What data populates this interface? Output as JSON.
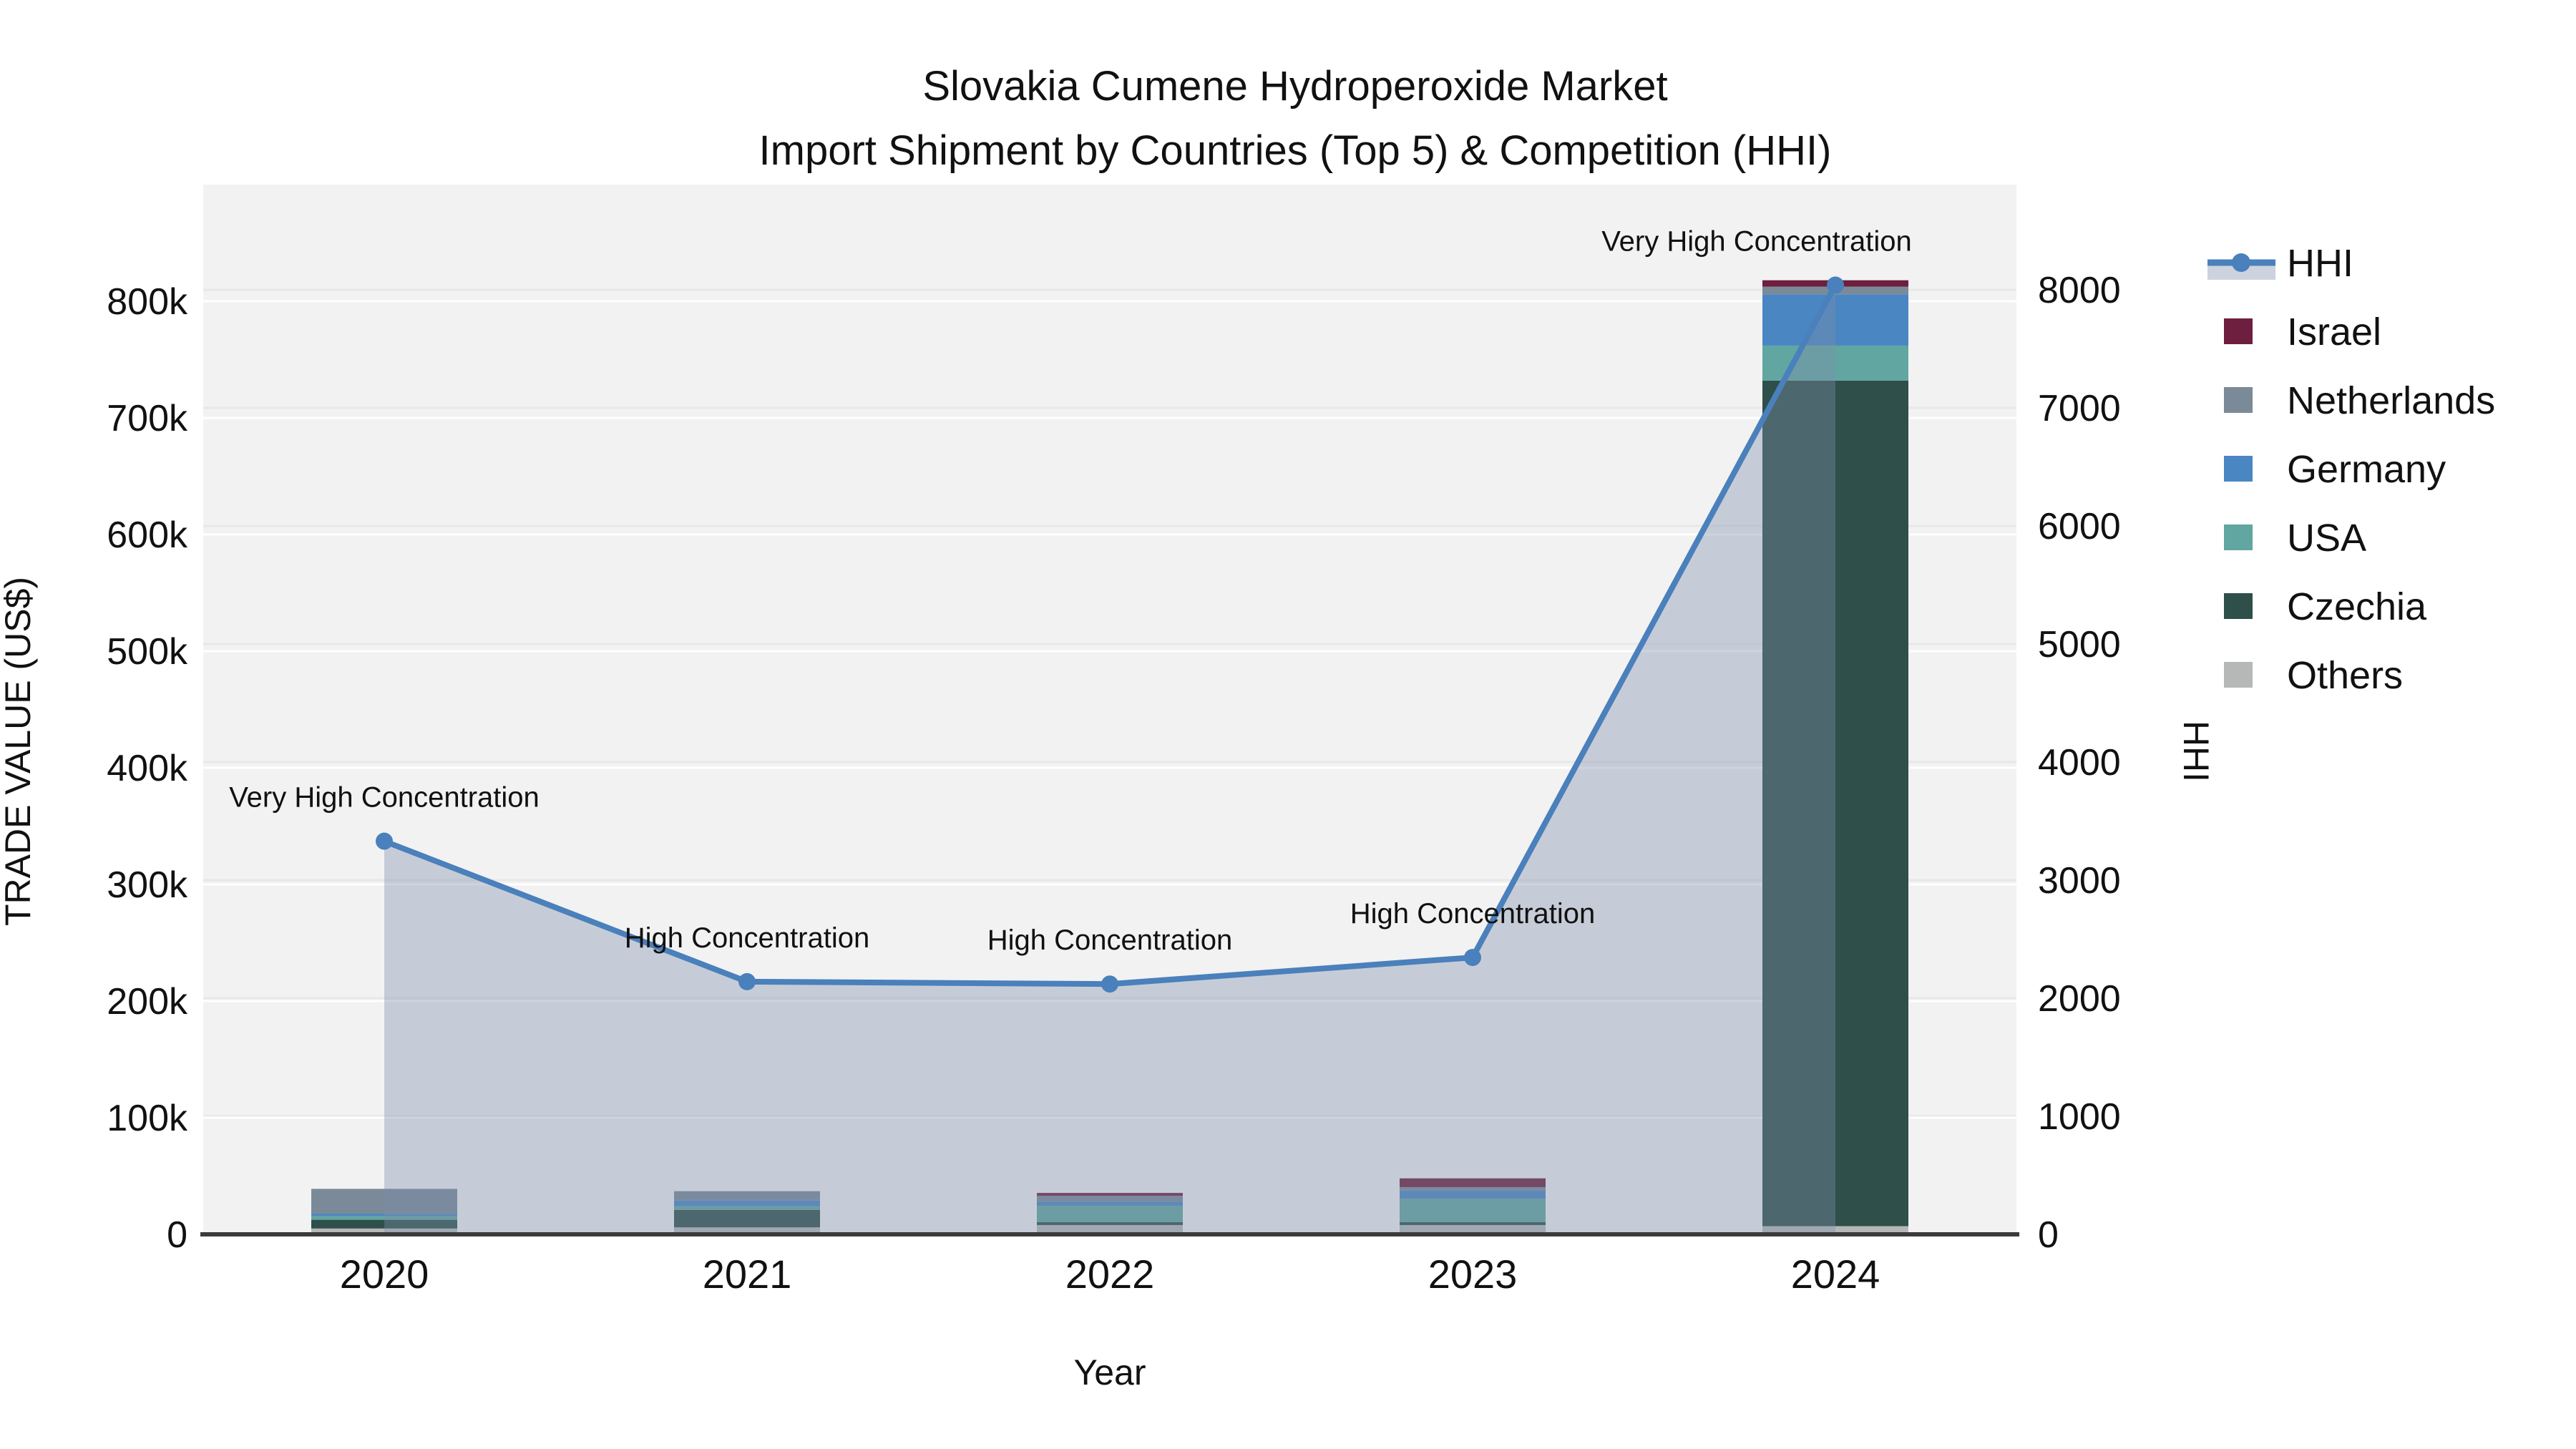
{
  "title": {
    "line1": "Slovakia Cumene Hydroperoxide Market",
    "line2": "Import Shipment by Countries (Top 5) & Competition (HHI)"
  },
  "axes": {
    "x_title": "Year",
    "y_left_title": "TRADE VALUE (US$)",
    "y_right_title": "HHI",
    "y_left_ticks": [
      "0",
      "100k",
      "200k",
      "300k",
      "400k",
      "500k",
      "600k",
      "700k",
      "800k"
    ],
    "y_right_ticks": [
      "0",
      "1000",
      "2000",
      "3000",
      "4000",
      "5000",
      "6000",
      "7000",
      "8000"
    ]
  },
  "colors": {
    "hhi_line": "#4a80bb",
    "hhi_area": "rgba(125,142,170,0.38)",
    "hhi_legend_band": "#ccd3de",
    "plot_bg": "#f2f2f2",
    "grid_left": "#ffffff",
    "grid_right": "#e8e8e8",
    "axis_line": "#3b3b3b",
    "israel": "#6e1e3e",
    "netherlands": "#7a8a98",
    "germany": "#4a86c2",
    "usa": "#61a6a1",
    "czechia": "#2e4f4a",
    "others": "#b5b8b6"
  },
  "legend": {
    "items": [
      {
        "label": "HHI",
        "kind": "line",
        "color_key": "hhi_line"
      },
      {
        "label": "Israel",
        "kind": "swatch",
        "color_key": "israel"
      },
      {
        "label": "Netherlands",
        "kind": "swatch",
        "color_key": "netherlands"
      },
      {
        "label": "Germany",
        "kind": "swatch",
        "color_key": "germany"
      },
      {
        "label": "USA",
        "kind": "swatch",
        "color_key": "usa"
      },
      {
        "label": "Czechia",
        "kind": "swatch",
        "color_key": "czechia"
      },
      {
        "label": "Others",
        "kind": "swatch",
        "color_key": "others"
      }
    ]
  },
  "chart_data": {
    "type": "bar+line combo (stacked bars left axis, HHI line right axis)",
    "categories": [
      "2020",
      "2021",
      "2022",
      "2023",
      "2024"
    ],
    "bar_unit": "US$",
    "bar_series_bottom_to_top": [
      {
        "name": "Others",
        "color_key": "others",
        "values": [
          5000,
          6000,
          8000,
          8000,
          7000
        ]
      },
      {
        "name": "Czechia",
        "color_key": "czechia",
        "values": [
          7500,
          15000,
          2500,
          2500,
          725000
        ]
      },
      {
        "name": "USA",
        "color_key": "usa",
        "values": [
          3000,
          3000,
          14000,
          20000,
          30000
        ]
      },
      {
        "name": "Germany",
        "color_key": "germany",
        "values": [
          2000,
          5000,
          3500,
          7000,
          44000
        ]
      },
      {
        "name": "Netherlands",
        "color_key": "netherlands",
        "values": [
          21500,
          8000,
          5000,
          3000,
          6500
        ]
      },
      {
        "name": "Israel",
        "color_key": "israel",
        "values": [
          0,
          0,
          2500,
          7500,
          5500
        ]
      }
    ],
    "line_series": {
      "name": "HHI",
      "values": [
        3330,
        2140,
        2120,
        2345,
        8040
      ]
    },
    "annotations": [
      "Very High Concentration",
      "High Concentration",
      "High Concentration",
      "High Concentration",
      "Very High Concentration"
    ],
    "annotation_dx": [
      0,
      0,
      0,
      0,
      -110
    ],
    "ylim_left": [
      0,
      890000
    ],
    "ylim_right": [
      0,
      8900
    ],
    "grid": "on",
    "legend_position": "right"
  }
}
